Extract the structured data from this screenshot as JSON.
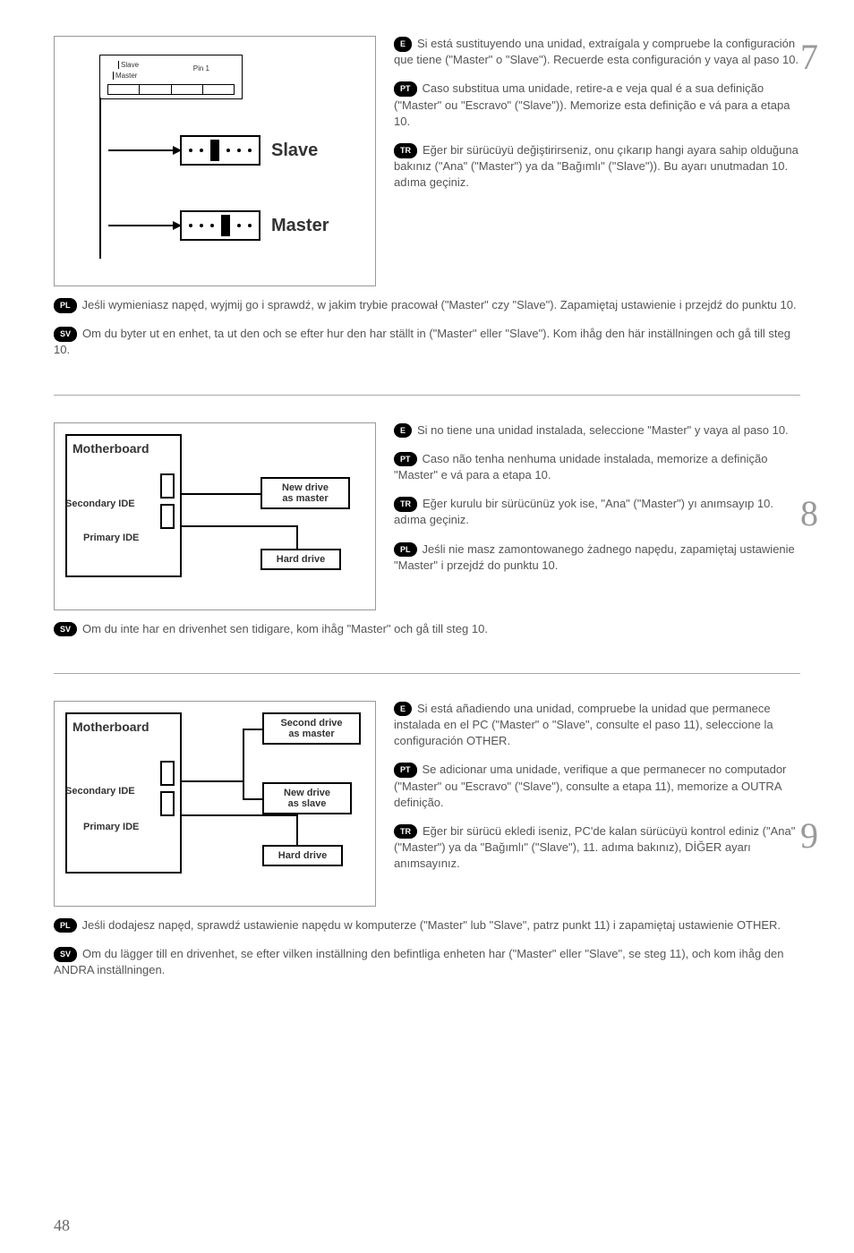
{
  "pageNumber": "48",
  "step7": {
    "number": "7",
    "diagram": {
      "slaveLabel": "Slave",
      "masterLabel": "Master",
      "pinLabel": "Pin 1",
      "jSlave": "Slave",
      "jMaster": "Master"
    },
    "langs": {
      "e": "Si está sustituyendo una unidad, extraígala y compruebe la configuración que tiene (\"Master\" o \"Slave\"). Recuerde esta configuración y vaya al paso 10.",
      "pt": "Caso substitua uma unidade, retire-a e veja qual é a sua definição (\"Master\" ou \"Escravo\" (\"Slave\")). Memorize esta definição e vá para a etapa 10.",
      "tr": "Eğer bir sürücüyü değiştirirseniz, onu çıkarıp hangi ayara sahip olduğuna bakınız (\"Ana\" (\"Master\") ya da \"Bağımlı\" (\"Slave\")). Bu ayarı unutmadan 10. adıma geçiniz.",
      "pl": "Jeśli wymieniasz napęd, wyjmij go i sprawdź, w jakim trybie pracował (\"Master\" czy \"Slave\"). Zapamiętaj ustawienie i przejdź do punktu 10.",
      "sv": "Om du byter ut en enhet, ta ut den och se efter hur den har ställt in (\"Master\" eller \"Slave\"). Kom ihåg den här inställningen och gå till steg 10."
    }
  },
  "step8": {
    "number": "8",
    "diagram": {
      "mb": "Motherboard",
      "sec": "Secondary IDE",
      "pri": "Primary IDE",
      "new": "New drive\nas master",
      "hd": "Hard drive"
    },
    "langs": {
      "e": "Si no tiene una unidad instalada, seleccione \"Master\" y vaya al paso 10.",
      "pt": "Caso não tenha nenhuma unidade instalada, memorize a definição \"Master\" e vá para a etapa 10.",
      "tr": "Eğer kurulu bir sürücünüz yok ise, \"Ana\" (\"Master\") yı anımsayıp 10. adıma geçiniz.",
      "pl": "Jeśli nie masz zamontowanego żadnego napędu, zapamiętaj ustawienie \"Master\" i przejdź do punktu 10.",
      "sv": "Om du inte har en drivenhet sen tidigare, kom ihåg \"Master\" och gå till steg 10."
    }
  },
  "step9": {
    "number": "9",
    "diagram": {
      "mb": "Motherboard",
      "sec": "Secondary IDE",
      "pri": "Primary IDE",
      "second": "Second drive\nas master",
      "new": "New drive\nas slave",
      "hd": "Hard drive"
    },
    "langs": {
      "e": "Si está añadiendo una unidad, compruebe la unidad que permanece instalada en el PC (\"Master\" o \"Slave\", consulte el paso 11), seleccione la configuración OTHER.",
      "pt": "Se adicionar uma unidade, verifique a que permanecer no computador (\"Master\" ou \"Escravo\" (\"Slave\"), consulte a etapa 11), memorize a OUTRA definição.",
      "tr": "Eğer bir sürücü ekledi iseniz, PC'de kalan sürücüyü kontrol ediniz (\"Ana\" (\"Master\") ya da \"Bağımlı\" (\"Slave\"), 11. adıma bakınız), DİĞER ayarı anımsayınız.",
      "pl": "Jeśli dodajesz napęd, sprawdź ustawienie napędu w komputerze (\"Master\" lub \"Slave\", patrz punkt 11) i zapamiętaj ustawienie OTHER.",
      "sv": "Om du lägger till en drivenhet, se efter vilken inställning den befintliga enheten har (\"Master\" eller \"Slave\", se steg 11), och kom ihåg den ANDRA inställningen."
    }
  },
  "langCodes": {
    "e": "E",
    "pt": "PT",
    "tr": "TR",
    "pl": "PL",
    "sv": "SV"
  }
}
